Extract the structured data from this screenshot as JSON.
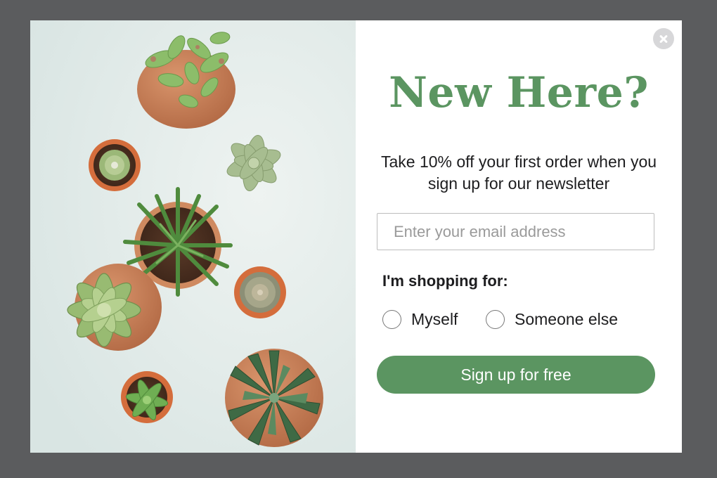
{
  "popup": {
    "headline": "New Here?",
    "subtext": "Take 10% off your first order when you sign up for our newsletter",
    "email_placeholder": "Enter your email address",
    "shopping_label": "I'm shopping for:",
    "options": [
      "Myself",
      "Someone else"
    ],
    "selected_option": null,
    "submit_label": "Sign up for free",
    "close_icon": "close-icon",
    "image": "succulents-photo"
  },
  "colors": {
    "overlay": "#5b5c5e",
    "accent": "#5b9561",
    "panel": "#ffffff",
    "text": "#1d1d1f"
  }
}
